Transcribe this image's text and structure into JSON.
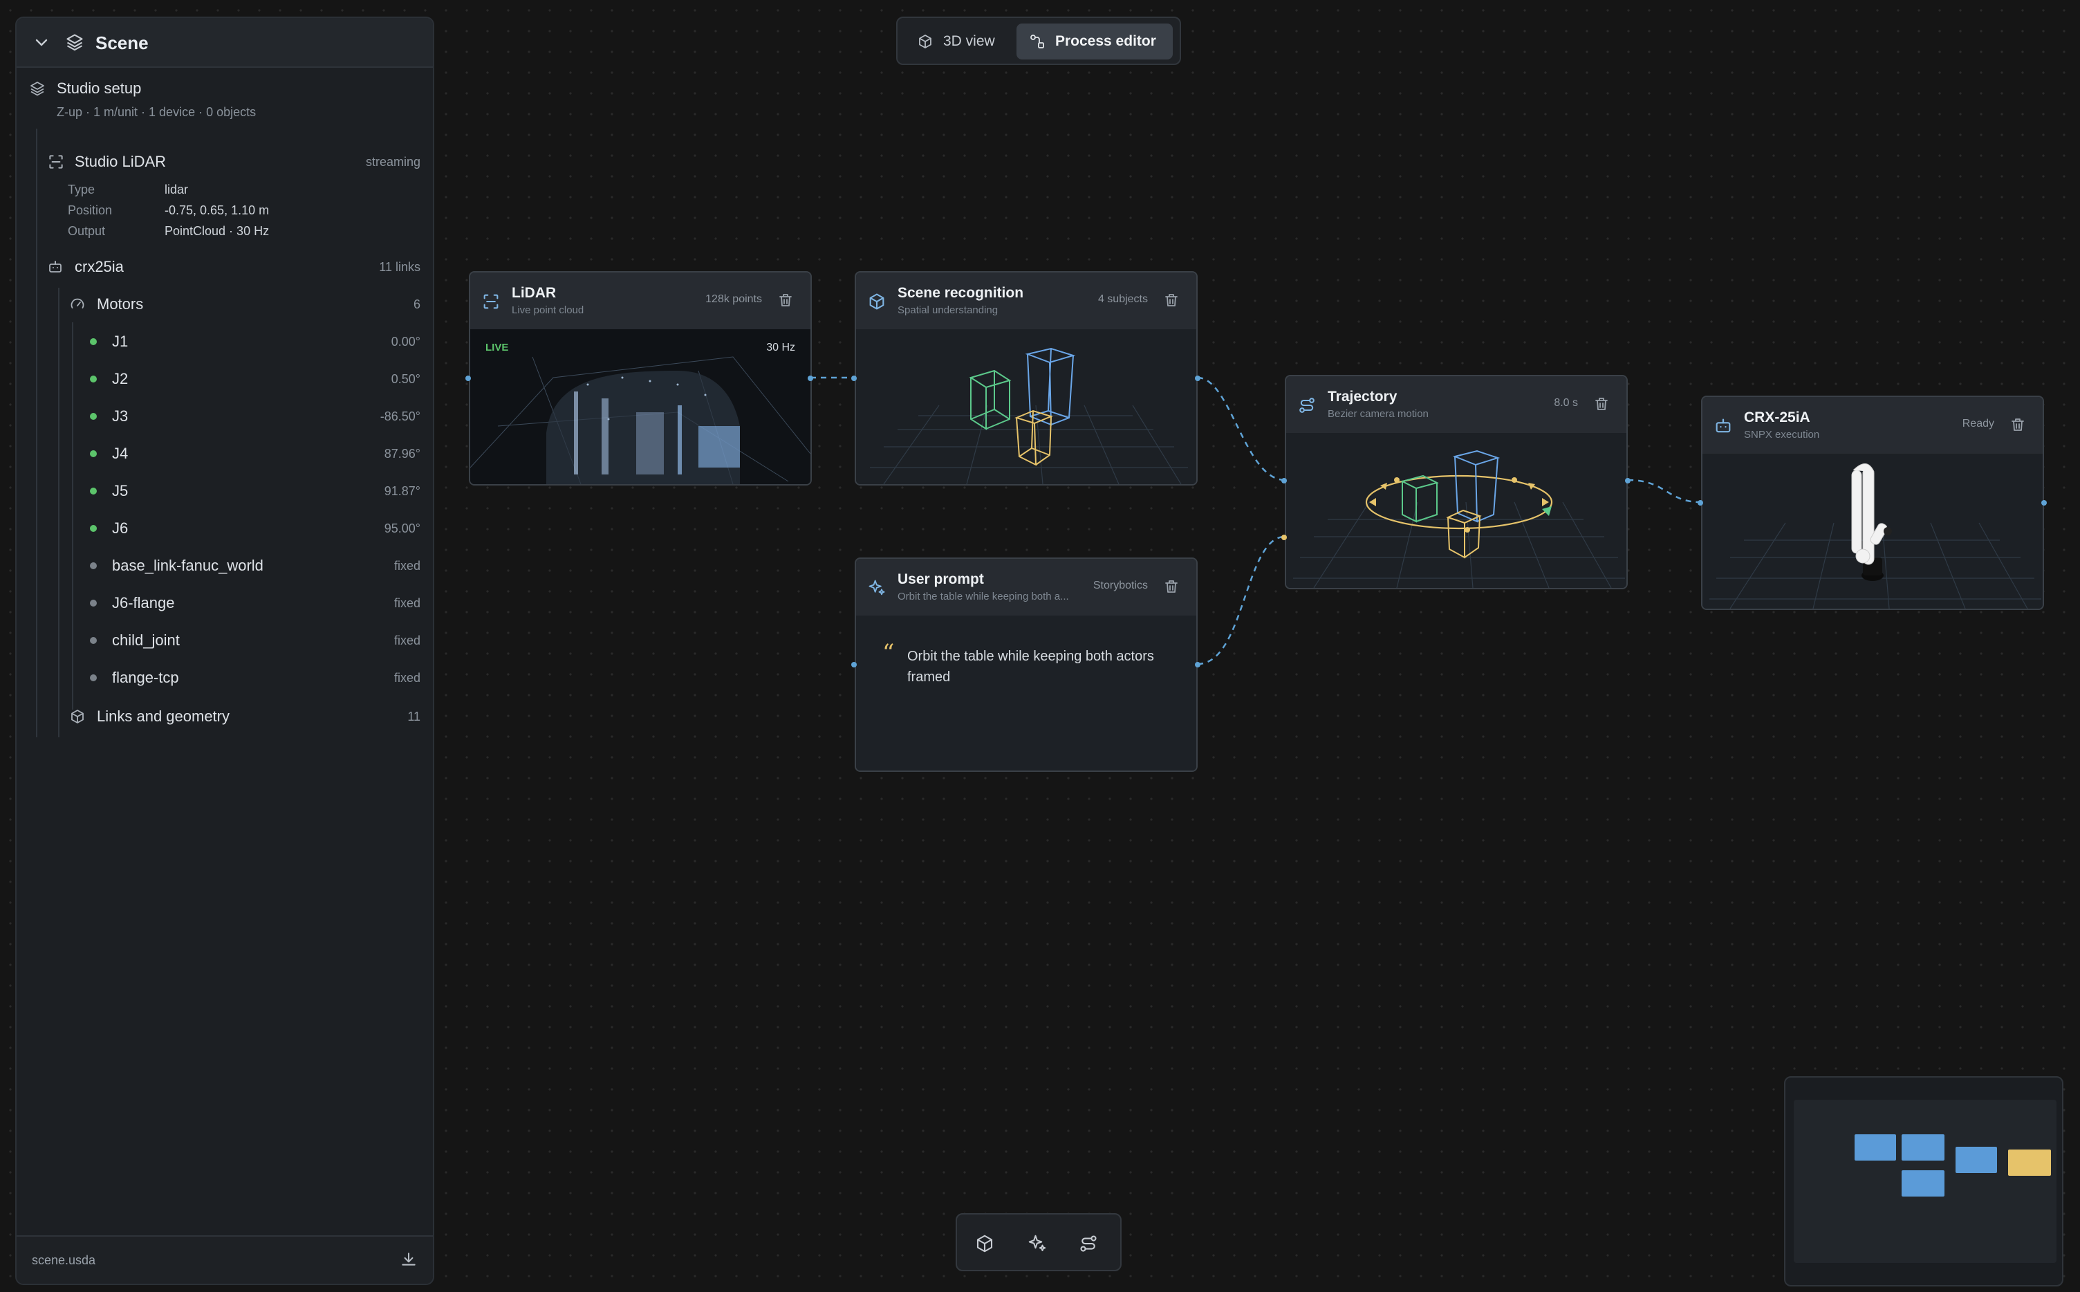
{
  "sidebar": {
    "title": "Scene",
    "setup": {
      "label": "Studio setup",
      "summary": "Z-up · 1 m/unit · 1 device · 0 objects"
    },
    "lidar": {
      "label": "Studio LiDAR",
      "status": "streaming",
      "props": [
        {
          "key": "Type",
          "value": "lidar"
        },
        {
          "key": "Position",
          "value": "-0.75, 0.65, 1.10 m"
        },
        {
          "key": "Output",
          "value": "PointCloud · 30 Hz"
        }
      ]
    },
    "robot": {
      "label": "crx25ia",
      "meta": "11 links"
    },
    "motors": {
      "label": "Motors",
      "count": "6"
    },
    "joints": [
      {
        "name": "J1",
        "value": "0.00°",
        "color": "#5cc46b"
      },
      {
        "name": "J2",
        "value": "0.50°",
        "color": "#5cc46b"
      },
      {
        "name": "J3",
        "value": "-86.50°",
        "color": "#5cc46b"
      },
      {
        "name": "J4",
        "value": "87.96°",
        "color": "#5cc46b"
      },
      {
        "name": "J5",
        "value": "91.87°",
        "color": "#5cc46b"
      },
      {
        "name": "J6",
        "value": "95.00°",
        "color": "#5cc46b"
      },
      {
        "name": "base_link-fanuc_world",
        "value": "fixed",
        "color": "#7b828a"
      },
      {
        "name": "J6-flange",
        "value": "fixed",
        "color": "#7b828a"
      },
      {
        "name": "child_joint",
        "value": "fixed",
        "color": "#7b828a"
      },
      {
        "name": "flange-tcp",
        "value": "fixed",
        "color": "#7b828a"
      }
    ],
    "links": {
      "label": "Links and geometry",
      "count": "11"
    },
    "footer": {
      "filename": "scene.usda"
    }
  },
  "view_toggle": {
    "view3d": "3D view",
    "process": "Process editor",
    "active": "Process editor"
  },
  "nodes": {
    "lidar": {
      "title": "LiDAR",
      "subtitle": "Live point cloud",
      "meta": "128k points",
      "badge": "LIVE",
      "rate": "30 Hz"
    },
    "scene": {
      "title": "Scene recognition",
      "subtitle": "Spatial understanding",
      "meta": "4 subjects"
    },
    "prompt": {
      "title": "User prompt",
      "subtitle": "Orbit the table while keeping both a...",
      "meta": "Storybotics",
      "text": "Orbit the table while keeping both actors framed"
    },
    "trajectory": {
      "title": "Trajectory",
      "subtitle": "Bezier camera motion",
      "meta": "8.0 s"
    },
    "robot": {
      "title": "CRX-25iA",
      "subtitle": "SNPX execution",
      "meta": "Ready"
    }
  },
  "colors": {
    "accent": "#5fa3d6",
    "green": "#5cc46b",
    "yellow": "#e6c36a",
    "blue_wire": "#6aa6e8",
    "green_wire": "#5cc98b"
  },
  "icons": [
    "chevron-down-icon",
    "layers-icon",
    "scan-icon",
    "robot-icon",
    "gauge-icon",
    "cube-icon",
    "trash-icon",
    "sparkle-icon",
    "route-icon",
    "download-icon",
    "quote-icon",
    "flow-icon"
  ]
}
